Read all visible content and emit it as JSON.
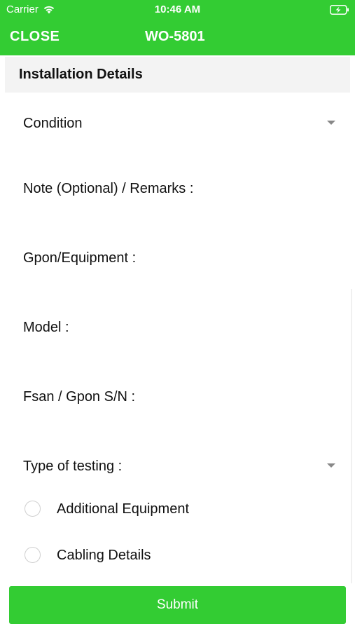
{
  "status_bar": {
    "carrier": "Carrier",
    "time": "10:46 AM",
    "wifi_icon": "wifi-icon",
    "battery_icon": "battery-charging-icon"
  },
  "header": {
    "close_label": "CLOSE",
    "title": "WO-5801",
    "background": "#33cc33"
  },
  "section": {
    "title": "Installation Details"
  },
  "fields": {
    "condition": "Condition",
    "note": "Note (Optional) / Remarks :",
    "gpon": "Gpon/Equipment :",
    "model": "Model :",
    "fsan": "Fsan / Gpon S/N :",
    "testing": "Type of testing :"
  },
  "options": {
    "additional_equipment": "Additional Equipment",
    "cabling_details": "Cabling Details"
  },
  "submit_label": "Submit",
  "colors": {
    "accent": "#33cc33",
    "section_bg": "#f3f3f3"
  }
}
